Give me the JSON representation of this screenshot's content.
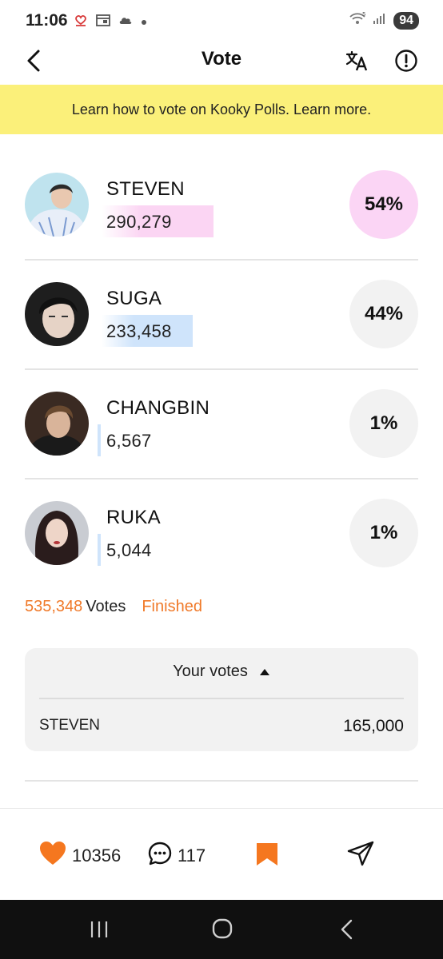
{
  "status_bar": {
    "time": "11:06",
    "battery": "94",
    "icons": [
      "notification-icon",
      "calendar-icon",
      "cloud-icon",
      "dot-icon",
      "wifi-icon",
      "signal-icon",
      "battery-icon"
    ]
  },
  "header": {
    "title": "Vote",
    "icons": [
      "back-arrow-icon",
      "translate-icon",
      "info-icon"
    ]
  },
  "banner": {
    "text": "Learn how to vote on Kooky Polls. Learn more."
  },
  "candidates": [
    {
      "name": "STEVEN",
      "votes": "290,279",
      "percent": "54%",
      "bar_fraction": 0.54,
      "bar_color": "#fbd5f3",
      "circle_color": "#fbd5f5"
    },
    {
      "name": "SUGA",
      "votes": "233,458",
      "percent": "44%",
      "bar_fraction": 0.44,
      "bar_color": "#cfe4fb",
      "circle_color": "#f2f2f2"
    },
    {
      "name": "CHANGBIN",
      "votes": "6,567",
      "percent": "1%",
      "bar_fraction": 0.01,
      "bar_color": "#cfe4fb",
      "circle_color": "#f2f2f2"
    },
    {
      "name": "RUKA",
      "votes": "5,044",
      "percent": "1%",
      "bar_fraction": 0.01,
      "bar_color": "#cfe4fb",
      "circle_color": "#f2f2f2"
    }
  ],
  "summary": {
    "total": "535,348",
    "votes_word": "Votes",
    "status": "Finished"
  },
  "your_votes": {
    "title": "Your votes",
    "name": "STEVEN",
    "count": "165,000"
  },
  "actions": {
    "likes": "10356",
    "comments": "117"
  },
  "colors": {
    "accent": "#f07a2a",
    "banner": "#fbf07a",
    "heart": "#f5771f"
  }
}
